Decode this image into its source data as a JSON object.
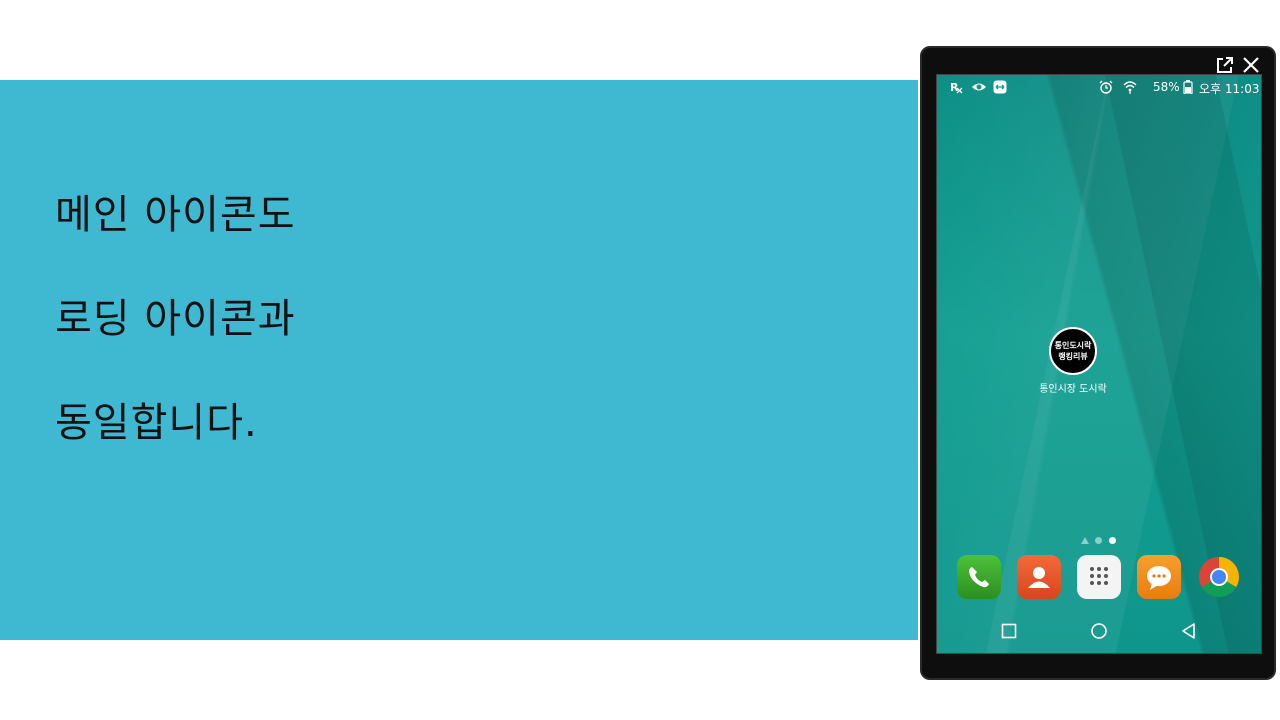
{
  "slide": {
    "lines": [
      "메인 아이콘도",
      "로딩 아이콘과",
      "동일합니다."
    ]
  },
  "window_controls": {
    "popout_icon": "external-link-icon",
    "close_icon": "close-icon"
  },
  "status_bar": {
    "left_icons": [
      "rx-icon",
      "eye-icon",
      "teamviewer-icon"
    ],
    "right_icons": [
      "alarm-icon",
      "wifi-icon",
      "battery-icon"
    ],
    "battery_percent": "58%",
    "time": "오후 11:03"
  },
  "home_app": {
    "icon_line1": "통인도시락",
    "icon_line2": "랭킹리뷰",
    "label": "통인시장 도시락"
  },
  "page_indicator": {
    "count": 3,
    "active_index": 2
  },
  "dock": [
    {
      "name": "phone-icon",
      "color": "#3aa52a"
    },
    {
      "name": "contacts-icon",
      "color": "#ea5a2a"
    },
    {
      "name": "apps-icon",
      "color": "#f2f2f2"
    },
    {
      "name": "messages-icon",
      "color": "#f08a1c"
    },
    {
      "name": "chrome-icon",
      "color": "#db4437"
    }
  ],
  "nav_bar": [
    "recents-button",
    "home-button",
    "back-button"
  ],
  "colors": {
    "slide_background": "#3fb8d1",
    "wallpaper": "#12988d"
  }
}
